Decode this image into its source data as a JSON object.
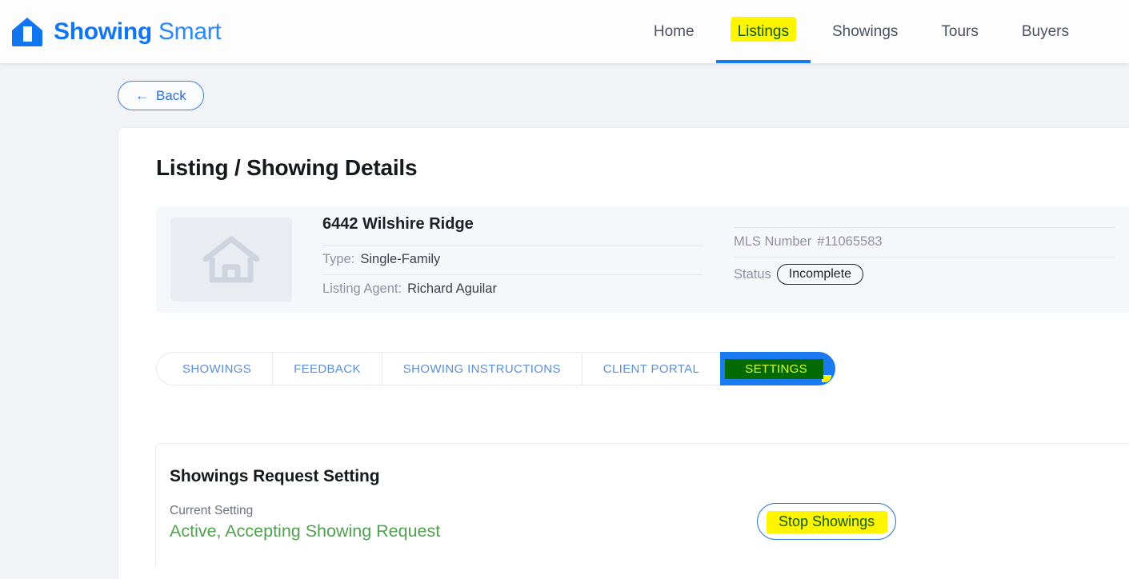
{
  "brand": {
    "name_strong": "Showing",
    "name_light": "Smart",
    "logo_icon": "house-logo-icon",
    "color": "#1175f0"
  },
  "nav": {
    "items": [
      {
        "label": "Home",
        "active": false
      },
      {
        "label": "Listings",
        "active": true
      },
      {
        "label": "Showings",
        "active": false
      },
      {
        "label": "Tours",
        "active": false
      },
      {
        "label": "Buyers",
        "active": false
      }
    ],
    "active_underline_color": "#1a7af0",
    "highlight_color": "#fff500",
    "highlight_text_color": "#0c5a0c"
  },
  "toolbar": {
    "back_label": "Back",
    "back_arrow": "←"
  },
  "main": {
    "page_title": "Listing / Showing Details",
    "property": {
      "thumbnail_icon": "house-placeholder-icon",
      "address": "6442 Wilshire Ridge",
      "left_rows": [
        {
          "label": "Type:",
          "value": "Single-Family"
        },
        {
          "label": "Listing Agent:",
          "value": "Richard Aguilar"
        }
      ],
      "mls_label": "MLS Number",
      "mls_number": "#11065583",
      "status_label": "Status",
      "status_value": "Incomplete"
    },
    "edge_icon": "chevron-right-icon",
    "tabs": [
      {
        "label": "SHOWINGS",
        "active": false
      },
      {
        "label": "FEEDBACK",
        "active": false
      },
      {
        "label": "SHOWING INSTRUCTIONS",
        "active": false
      },
      {
        "label": "CLIENT PORTAL",
        "active": false
      },
      {
        "label": "SETTINGS",
        "active": true
      }
    ],
    "settings_section": {
      "title": "Showings Request Setting",
      "current_setting_label": "Current Setting",
      "current_setting_value": "Active, Accepting Showing Request",
      "current_setting_color": "#50a14f",
      "stop_button_label": "Stop Showings"
    }
  }
}
